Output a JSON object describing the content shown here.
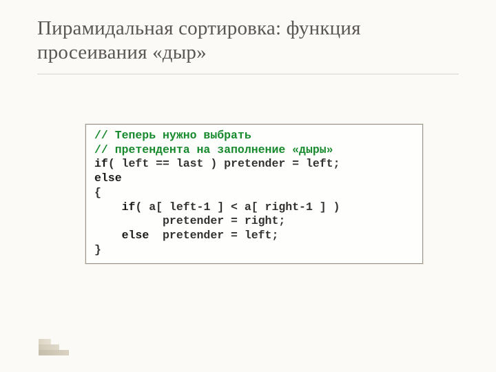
{
  "slide": {
    "title": "Пирамидальная сортировка: функция просеивания «дыр»"
  },
  "code": {
    "c1": "// Теперь нужно выбрать",
    "c2": "// претендента на заполнение «дыры»",
    "l3a": "if",
    "l3b": "( left == last ) pretender = left;",
    "l4a": "else",
    "l5": "{",
    "l6a": "if",
    "l6b": "( a[ left-1 ] < a[ right-1 ] )",
    "l7": "pretender = right;",
    "l8a": "else",
    "l8b": "  pretender = left;",
    "l9": "}"
  }
}
